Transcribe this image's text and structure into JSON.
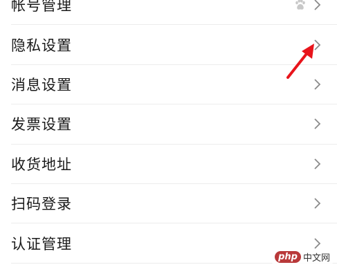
{
  "settings": {
    "items": [
      {
        "label": "帐号管理",
        "has_badge": true
      },
      {
        "label": "隐私设置"
      },
      {
        "label": "消息设置"
      },
      {
        "label": "发票设置"
      },
      {
        "label": "收货地址"
      },
      {
        "label": "扫码登录"
      },
      {
        "label": "认证管理"
      }
    ]
  },
  "icons": {
    "chevron": "chevron-right-icon",
    "badge": "paw-icon",
    "annotation": "red-arrow"
  },
  "colors": {
    "text": "#1a1a1a",
    "chevron": "#8a8a8a",
    "divider": "#ececec",
    "annotation": "#e8141b",
    "watermark_logo": "#b9393a"
  },
  "watermark": {
    "logo": "php",
    "text": "中文网"
  }
}
